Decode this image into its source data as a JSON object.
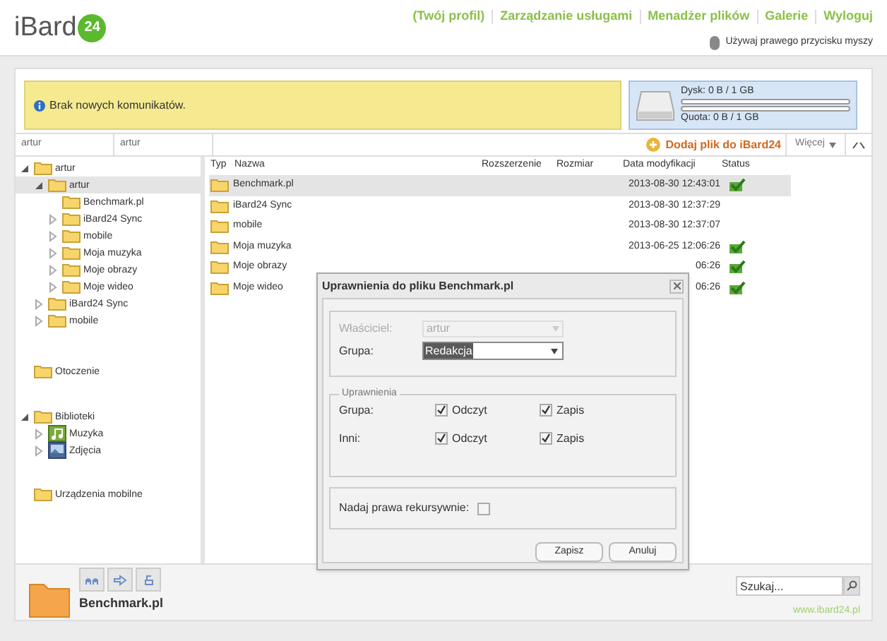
{
  "logo": {
    "text": "iBard",
    "badge": "24"
  },
  "nav": [
    "(Twój profil)",
    "Zarządzanie usługami",
    "Menadżer plików",
    "Galerie",
    "Wyloguj"
  ],
  "mouse_hint": "Używaj prawego przycisku myszy",
  "message": "Brak nowych komunikatów.",
  "storage": {
    "disk_label": "Dysk: 0 B / 1 GB",
    "quota_label": "Quota: 0 B / 1 GB"
  },
  "breadcrumb": [
    "artur",
    "artur"
  ],
  "toolbar": {
    "add": "Dodaj plik do iBard24",
    "more": "Więcej"
  },
  "tree": [
    {
      "label": "artur",
      "kind": "folder",
      "expanded": true,
      "selected": false,
      "children": [
        {
          "label": "artur",
          "kind": "folder",
          "expanded": true,
          "selected": true,
          "children": [
            {
              "label": "Benchmark.pl",
              "kind": "plain",
              "selected": false
            },
            {
              "label": "iBard24 Sync",
              "kind": "folder",
              "expanded": false,
              "selected": false
            },
            {
              "label": "mobile",
              "kind": "folder",
              "expanded": false,
              "selected": false
            },
            {
              "label": "Moja muzyka",
              "kind": "folder",
              "expanded": false,
              "selected": false
            },
            {
              "label": "Moje obrazy",
              "kind": "folder",
              "expanded": false,
              "selected": false
            },
            {
              "label": "Moje wideo",
              "kind": "folder",
              "expanded": false,
              "selected": false
            }
          ]
        },
        {
          "label": "iBard24 Sync",
          "kind": "folder",
          "expanded": false,
          "selected": false
        },
        {
          "label": "mobile",
          "kind": "folder",
          "expanded": false,
          "selected": false
        }
      ]
    }
  ],
  "sections": [
    {
      "label": "Otoczenie",
      "kind": "plain",
      "selected": false
    },
    {
      "label": "Biblioteki",
      "kind": "folder",
      "expanded": true,
      "selected": false,
      "children": [
        {
          "label": "Muzyka",
          "kind": "music",
          "expanded": false,
          "selected": false
        },
        {
          "label": "Zdjęcia",
          "kind": "photos",
          "expanded": false,
          "selected": false
        }
      ]
    },
    {
      "label": "Urządzenia mobilne",
      "kind": "plain",
      "selected": false
    }
  ],
  "table": {
    "columns": [
      "Typ",
      "Nazwa",
      "Rozszerzenie",
      "Rozmiar",
      "Data modyfikacji",
      "Status"
    ],
    "rows": [
      {
        "name": "Benchmark.pl",
        "date": "2013-08-30 12:43:01",
        "synced": true,
        "selected": true
      },
      {
        "name": "iBard24 Sync",
        "date": "2013-08-30 12:37:29",
        "synced": false,
        "selected": false
      },
      {
        "name": "mobile",
        "date": "2013-08-30 12:37:07",
        "synced": false,
        "selected": false
      },
      {
        "name": "Moja muzyka",
        "date": "2013-06-25 12:06:26",
        "synced": true,
        "selected": false
      },
      {
        "name": "Moje obrazy",
        "date": "06:26",
        "synced": true,
        "selected": false
      },
      {
        "name": "Moje wideo",
        "date": "06:26",
        "synced": true,
        "selected": false
      }
    ]
  },
  "dialog": {
    "title": "Uprawnienia do pliku Benchmark.pl",
    "owner_label": "Właściciel:",
    "owner_value": "artur",
    "owner_disabled": true,
    "group_label": "Grupa:",
    "group_value": "Redakcja",
    "permissions_legend": "Uprawnienia",
    "permissions": [
      {
        "label": "Grupa:",
        "read": {
          "label": "Odczyt",
          "checked": true
        },
        "write": {
          "label": "Zapis",
          "checked": true
        }
      },
      {
        "label": "Inni:",
        "read": {
          "label": "Odczyt",
          "checked": true
        },
        "write": {
          "label": "Zapis",
          "checked": true
        }
      }
    ],
    "recursive": {
      "label": "Nadaj prawa rekursywnie:",
      "checked": false
    },
    "buttons": [
      "Zapisz",
      "Anuluj"
    ]
  },
  "footer": {
    "selected_name": "Benchmark.pl",
    "search_placeholder": "Szukaj...",
    "site": "www.ibard24.pl"
  }
}
